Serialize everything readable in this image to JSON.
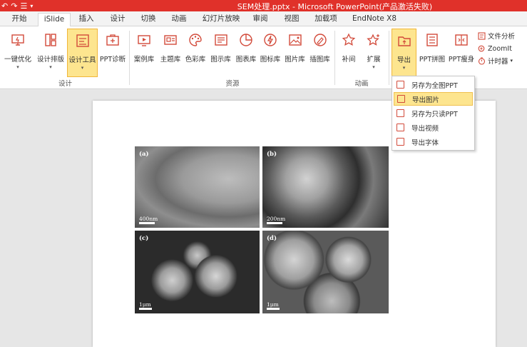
{
  "window": {
    "title": "SEM处理.pptx - Microsoft PowerPoint(产品激活失败)"
  },
  "tabs": [
    {
      "label": "开始"
    },
    {
      "label": "iSlide"
    },
    {
      "label": "插入"
    },
    {
      "label": "设计"
    },
    {
      "label": "切换"
    },
    {
      "label": "动画"
    },
    {
      "label": "幻灯片放映"
    },
    {
      "label": "审阅"
    },
    {
      "label": "视图"
    },
    {
      "label": "加载项"
    },
    {
      "label": "EndNote X8"
    }
  ],
  "ribbon": {
    "design_group": {
      "label": "设计",
      "buttons": [
        "一键优化",
        "设计排版",
        "设计工具",
        "PPT诊断"
      ]
    },
    "resource_group": {
      "label": "资源",
      "buttons": [
        "案例库",
        "主题库",
        "色彩库",
        "图示库",
        "图表库",
        "图标库",
        "图片库",
        "插图库"
      ]
    },
    "animation_group": {
      "label": "动画",
      "buttons": [
        "补间",
        "扩展"
      ]
    },
    "export_group": {
      "buttons": [
        "导出",
        "PPT拼图",
        "PPT瘦身"
      ],
      "small": [
        "文件分析",
        "ZoomIt",
        "计时器"
      ]
    }
  },
  "export_menu": {
    "items": [
      "另存为全图PPT",
      "导出图片",
      "另存为只读PPT",
      "导出视频",
      "导出字体"
    ]
  },
  "slide": {
    "panels": [
      {
        "caption": "(a)",
        "scale": "400nm"
      },
      {
        "caption": "(b)",
        "scale": "200nm"
      },
      {
        "caption": "(c)",
        "scale": "1μm"
      },
      {
        "caption": "(d)",
        "scale": "1μm"
      }
    ]
  },
  "colors": {
    "accent": "#e0312a",
    "hover": "#fde58f"
  }
}
